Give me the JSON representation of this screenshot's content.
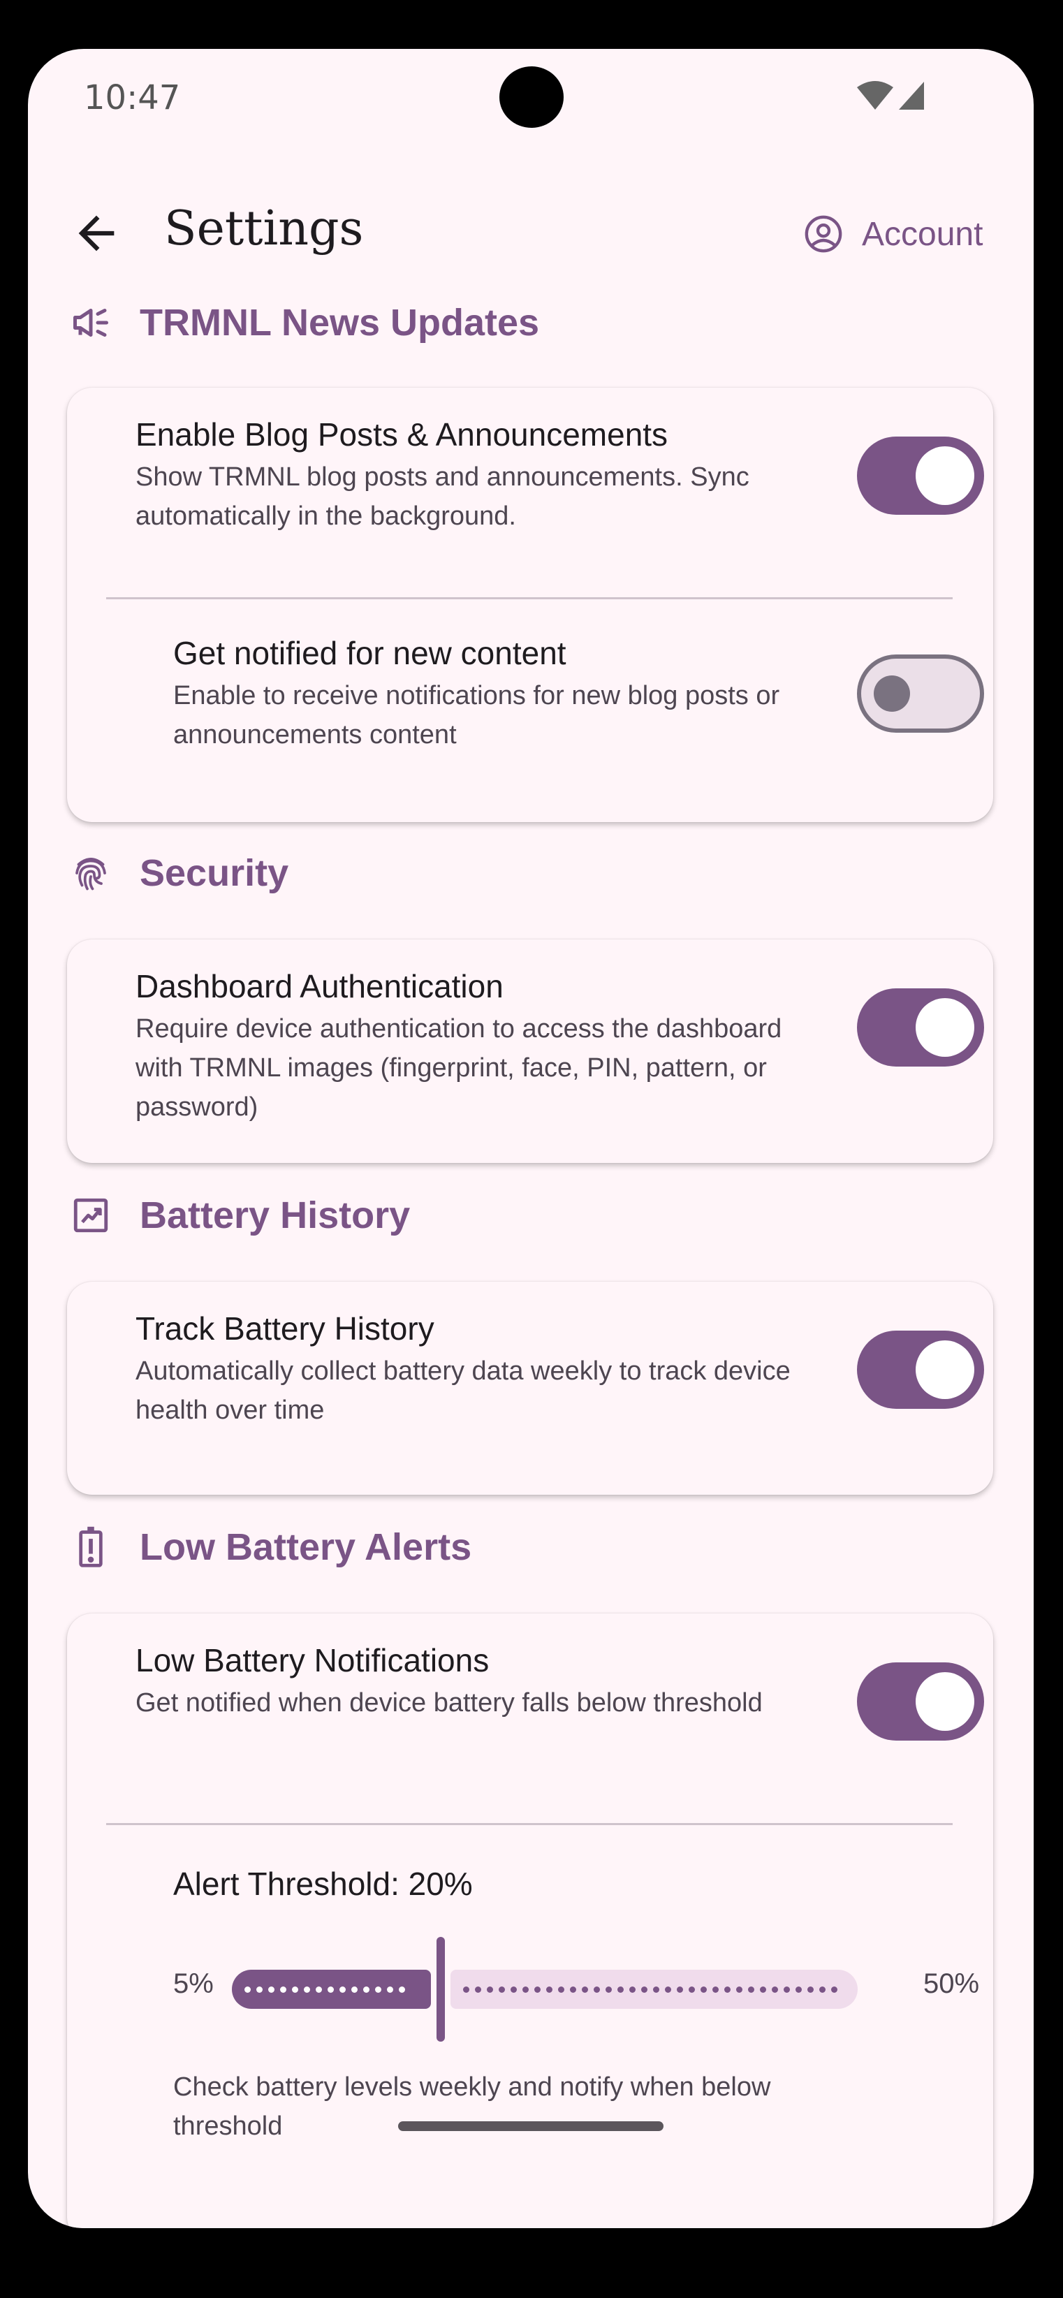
{
  "status_bar": {
    "time": "10:47"
  },
  "header": {
    "title": "Settings",
    "account_label": "Account"
  },
  "sections": {
    "news": {
      "title": "TRMNL News Updates",
      "items": [
        {
          "title": "Enable Blog Posts & Announcements",
          "description": "Show TRMNL blog posts and announcements. Sync automatically in the background.",
          "enabled": true
        },
        {
          "title": "Get notified for new content",
          "description": "Enable to receive notifications for new blog posts or announcements content",
          "enabled": false
        }
      ]
    },
    "security": {
      "title": "Security",
      "items": [
        {
          "title": "Dashboard Authentication",
          "description": "Require device authentication to access the dashboard with TRMNL images (fingerprint, face, PIN, pattern, or password)",
          "enabled": true
        }
      ]
    },
    "battery_history": {
      "title": "Battery History",
      "items": [
        {
          "title": "Track Battery History",
          "description": "Automatically collect battery data weekly to track device health over time",
          "enabled": true
        }
      ]
    },
    "low_battery": {
      "title": "Low Battery Alerts",
      "items": [
        {
          "title": "Low Battery Notifications",
          "description": "Get notified when device battery falls below threshold",
          "enabled": true
        }
      ],
      "threshold": {
        "label": "Alert Threshold: 20%",
        "min_label": "5%",
        "max_label": "50%",
        "value_percent": 20,
        "min": 5,
        "max": 50,
        "description": "Check battery levels weekly and notify when below threshold"
      }
    }
  },
  "colors": {
    "accent": "#7a5486",
    "background": "#fff5f9",
    "track_inactive": "#f0dcec"
  },
  "icons": [
    "back-arrow-icon",
    "account-circle-icon",
    "campaign-icon",
    "fingerprint-icon",
    "trending-chart-icon",
    "battery-alert-icon"
  ]
}
